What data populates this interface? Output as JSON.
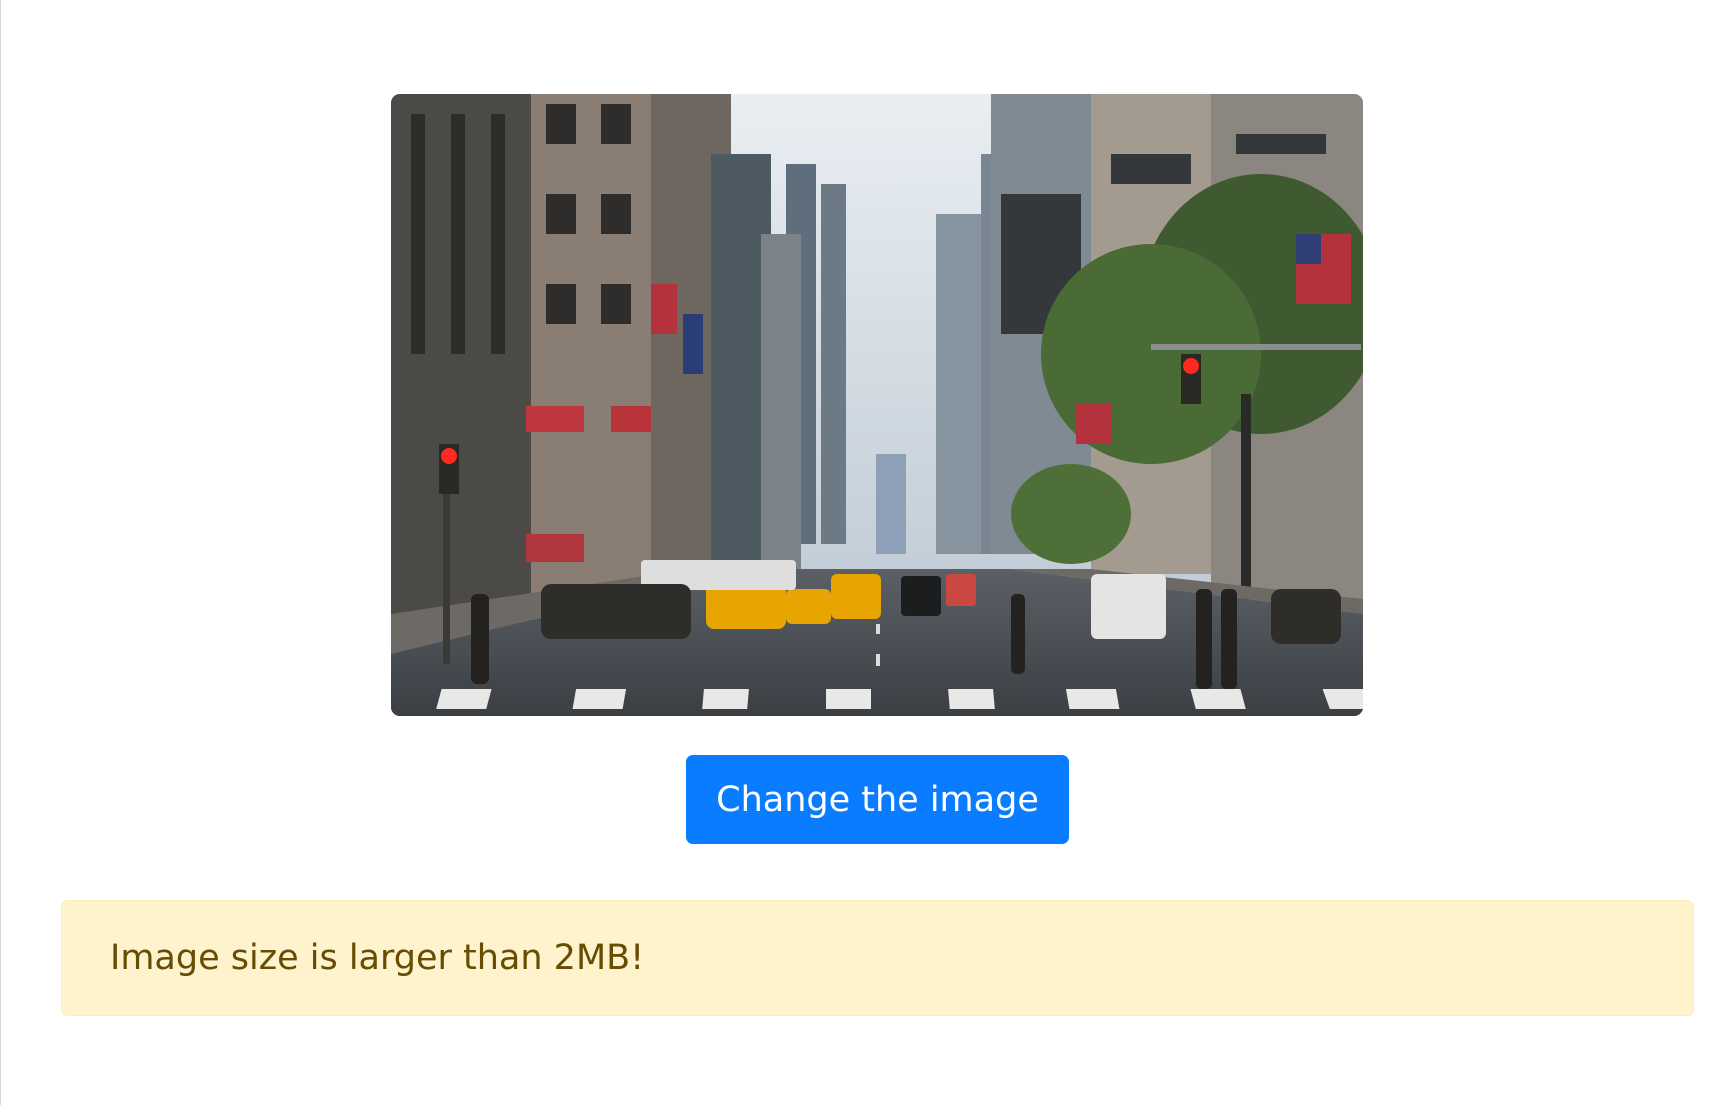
{
  "preview_image": {
    "alt": "City street with yellow taxis, pedestrians and tall buildings"
  },
  "button": {
    "label": "Change the image"
  },
  "alert": {
    "message": "Image size is larger than 2MB!"
  },
  "colors": {
    "button_bg": "#0a7cff",
    "button_text": "#ffffff",
    "alert_bg": "#fff3cd",
    "alert_border": "#ffecb5",
    "alert_text": "#664d03"
  }
}
